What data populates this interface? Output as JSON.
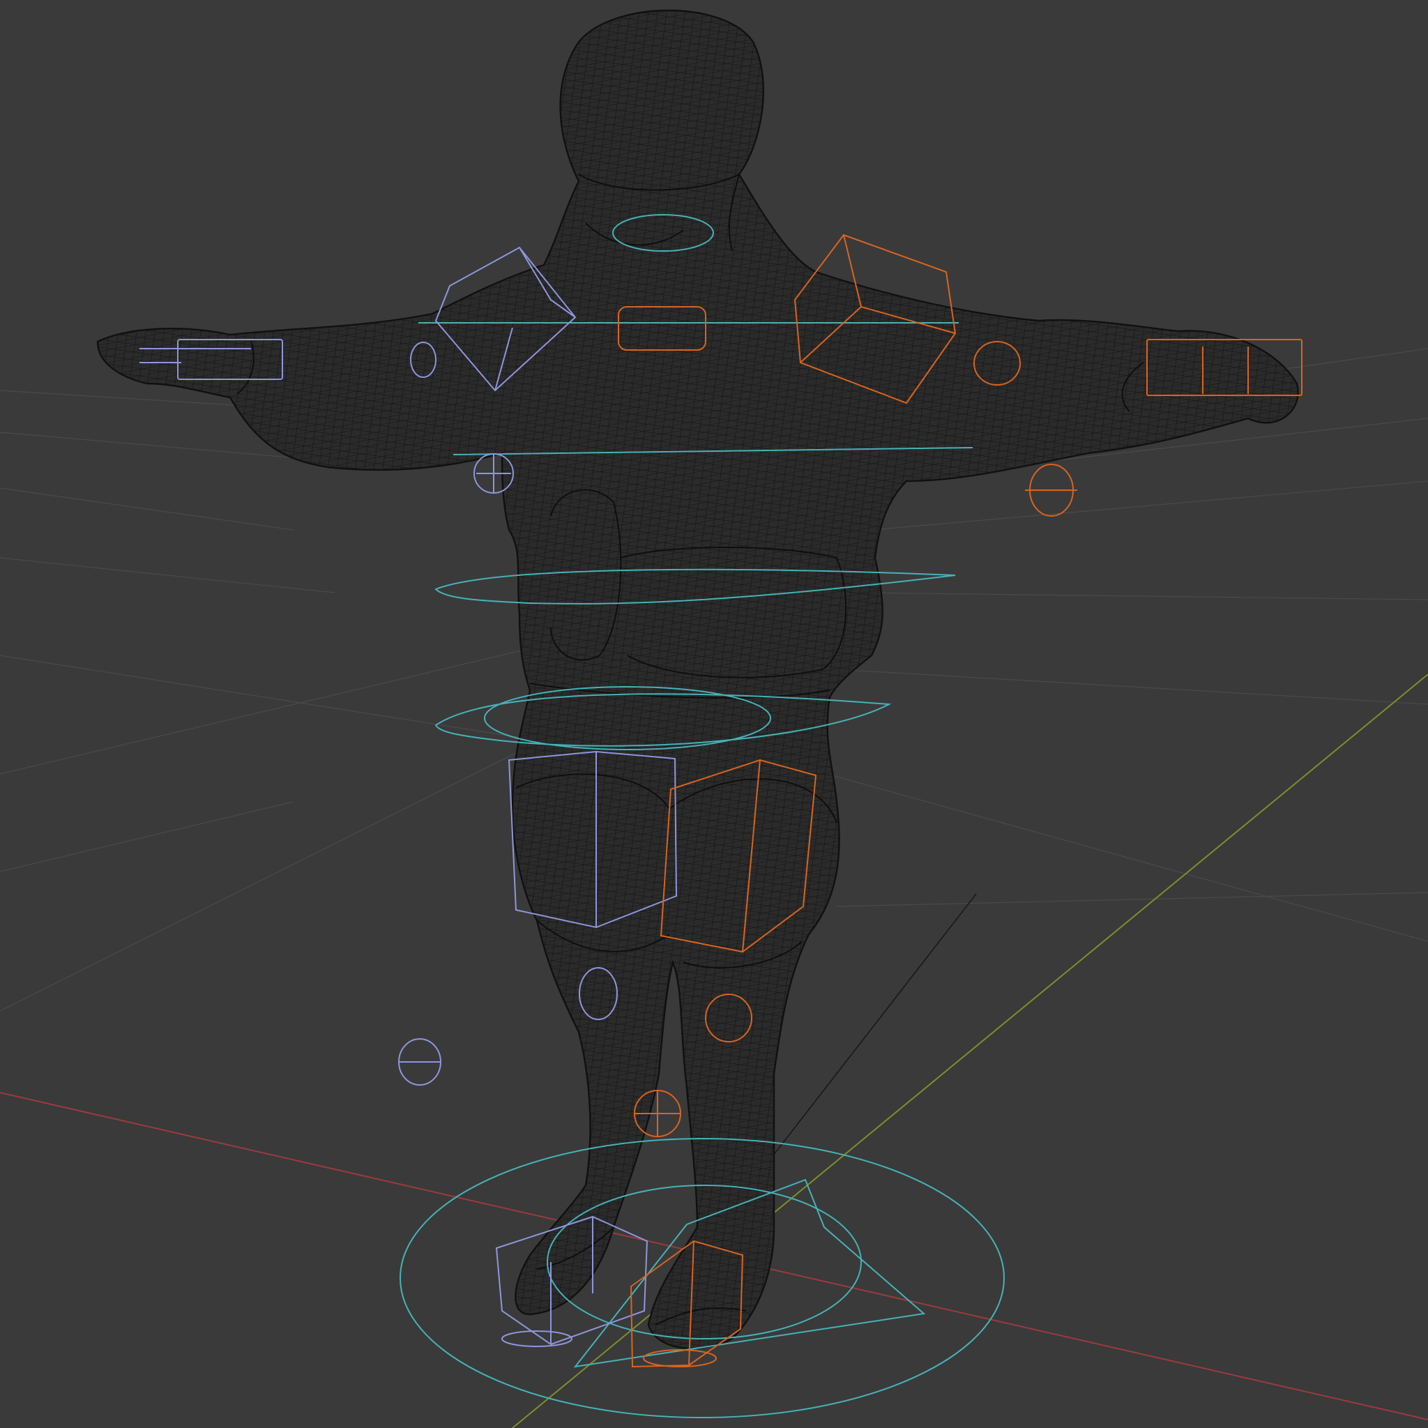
{
  "viewport": {
    "background": "#3a3a3a",
    "display_mode": "wireframe",
    "shows_text": false
  },
  "colors": {
    "grid_line": "#4a4a4a",
    "x_axis": "#9a3a3f",
    "y_axis": "#7c8f2a",
    "mesh_wire": "#141414",
    "control_center": "#45b3b8",
    "control_left": "#8e96dd",
    "control_right": "#d9641e",
    "relationship_line": "#161616"
  },
  "scene": {
    "object": "character-mesh",
    "pose": "T-pose",
    "rig_controls": [
      "root-circle-control",
      "head-ring-control",
      "shoulder-line-control",
      "chest-line-control",
      "waist-ring-control",
      "hip-ring-control",
      "left-hand-box-control",
      "right-hand-box-control",
      "left-shoulder-cube-control",
      "right-shoulder-cube-control",
      "left-thigh-box-control",
      "right-thigh-box-control",
      "left-foot-box-control",
      "right-foot-box-control",
      "left-elbow-pole-control",
      "right-elbow-pole-control",
      "left-knee-pole-control",
      "right-knee-pole-control"
    ]
  }
}
